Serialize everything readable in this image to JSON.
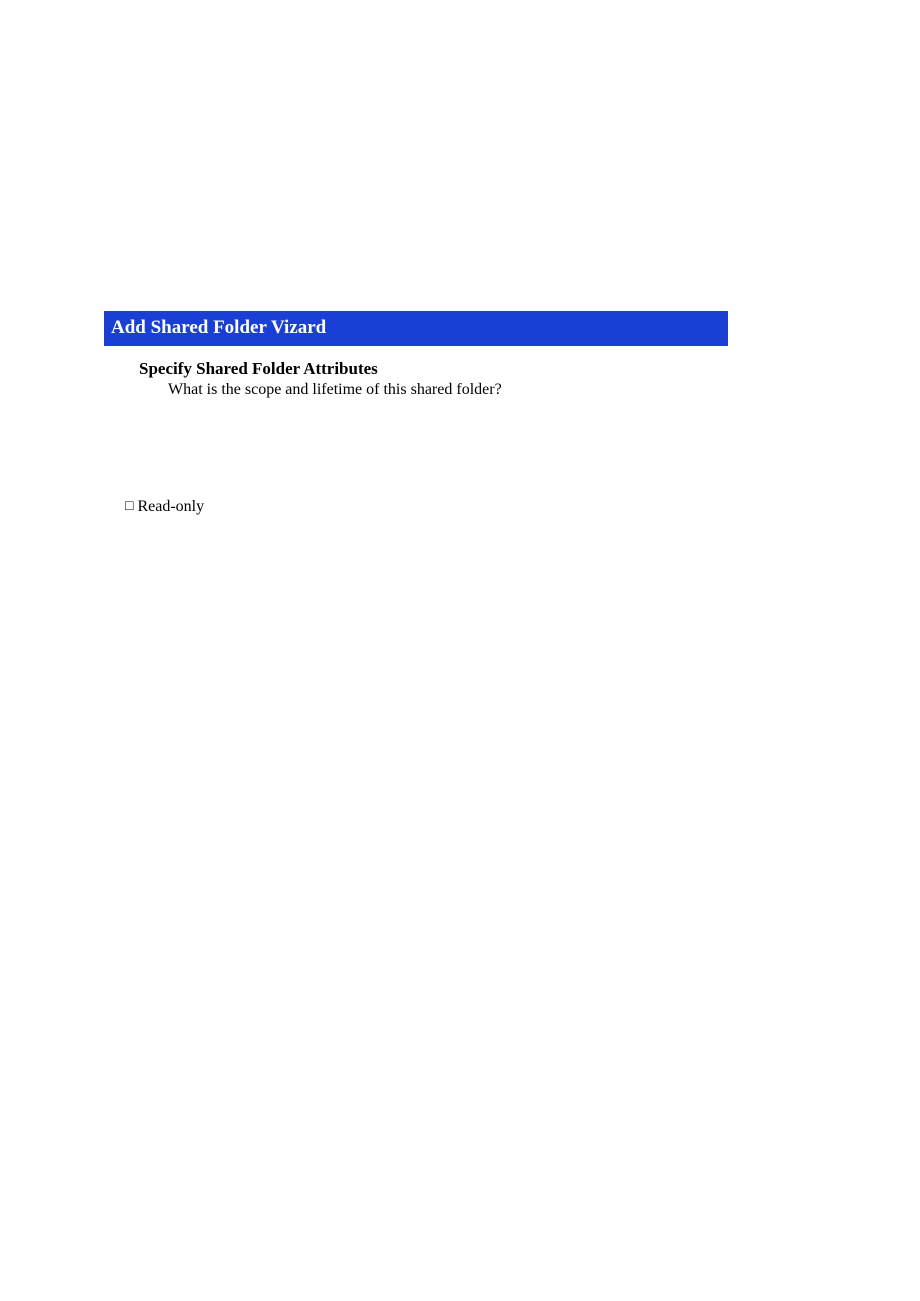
{
  "wizard": {
    "title": "Add Shared Folder Vizard",
    "header": {
      "title": "Specify Shared Folder Attributes",
      "subtitle": "What is the scope and lifetime of this shared folder?"
    },
    "options": {
      "read_only_label": "Read-only",
      "read_only_checked": false,
      "read_only_symbol": "□"
    }
  }
}
